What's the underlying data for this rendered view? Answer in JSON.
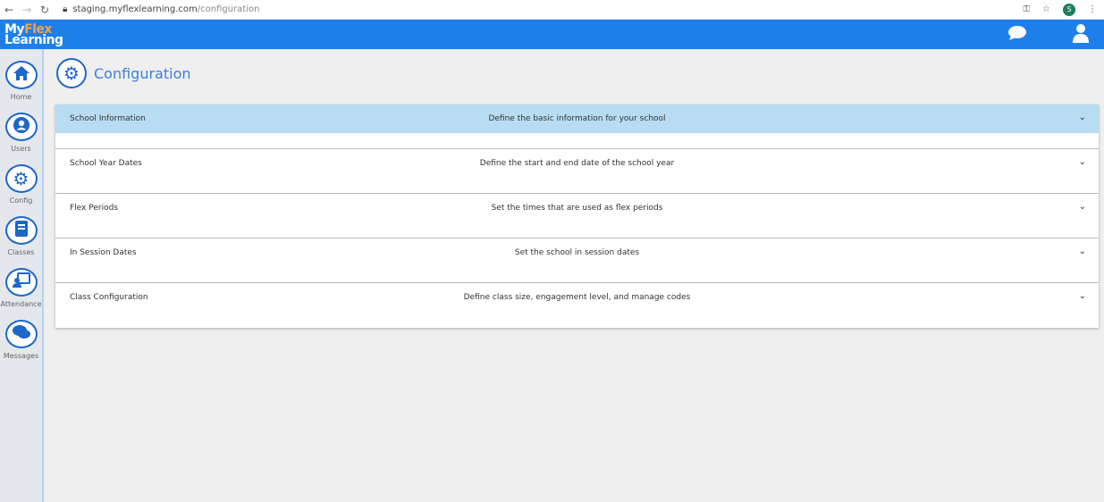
{
  "browser": {
    "url_host": "staging.myflexlearning.com",
    "url_path": "/configuration",
    "profile_initial": "S"
  },
  "logo": {
    "my": "My",
    "flex": "Flex",
    "learning": "Learning"
  },
  "sidebar": {
    "items": [
      {
        "label": "Home"
      },
      {
        "label": "Users"
      },
      {
        "label": "Config"
      },
      {
        "label": "Classes"
      },
      {
        "label": "Attendance"
      },
      {
        "label": "Messages"
      }
    ]
  },
  "page": {
    "title": "Configuration"
  },
  "sections": [
    {
      "title": "School Information",
      "description": "Define the basic information for your school"
    },
    {
      "title": "School Year Dates",
      "description": "Define the start and end date of the school year"
    },
    {
      "title": "Flex Periods",
      "description": "Set the times that are used as flex periods"
    },
    {
      "title": "In Session Dates",
      "description": "Set the school in session dates"
    },
    {
      "title": "Class Configuration",
      "description": "Define class size, engagement level, and manage codes"
    }
  ],
  "colors": {
    "brand": "#1e7fea",
    "accent": "#1e66c8",
    "active_row": "#b8dcf2"
  }
}
